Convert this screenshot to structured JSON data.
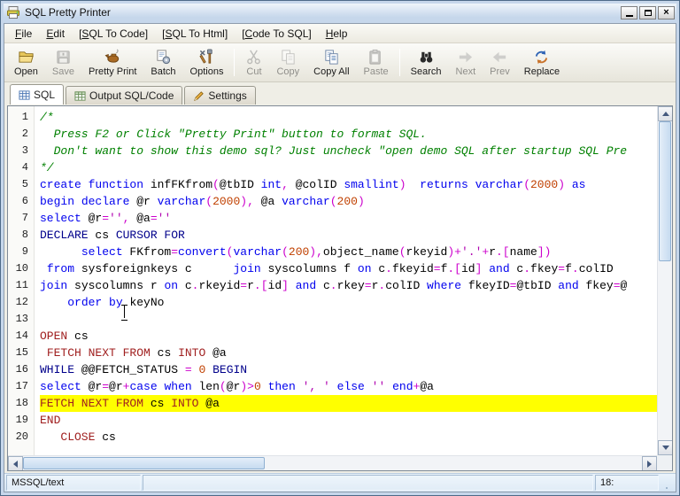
{
  "window": {
    "title": "SQL Pretty Printer"
  },
  "menu": {
    "items": [
      {
        "id": "file",
        "label": "File",
        "u": 0
      },
      {
        "id": "edit",
        "label": "Edit",
        "u": 0
      },
      {
        "id": "sql-to-code",
        "label": "[SQL To Code]",
        "u": 1
      },
      {
        "id": "sql-to-html",
        "label": "[SQL To Html]",
        "u": 1
      },
      {
        "id": "code-to-sql",
        "label": "[Code To SQL]",
        "u": 1
      },
      {
        "id": "help",
        "label": "Help",
        "u": 0
      }
    ]
  },
  "toolbar": {
    "buttons": [
      {
        "id": "open",
        "label": "Open",
        "icon": "open-folder-icon",
        "enabled": true
      },
      {
        "id": "save",
        "label": "Save",
        "icon": "save-icon",
        "enabled": false
      },
      {
        "id": "pretty-print",
        "label": "Pretty Print",
        "icon": "lamp-icon",
        "enabled": true
      },
      {
        "id": "batch",
        "label": "Batch",
        "icon": "batch-icon",
        "enabled": true
      },
      {
        "id": "options",
        "label": "Options",
        "icon": "tools-icon",
        "enabled": true
      },
      {
        "sep": true
      },
      {
        "id": "cut",
        "label": "Cut",
        "icon": "scissors-icon",
        "enabled": false
      },
      {
        "id": "copy",
        "label": "Copy",
        "icon": "copy-icon",
        "enabled": false
      },
      {
        "id": "copy-all",
        "label": "Copy All",
        "icon": "copy-all-icon",
        "enabled": true
      },
      {
        "id": "paste",
        "label": "Paste",
        "icon": "paste-icon",
        "enabled": false
      },
      {
        "sep": true
      },
      {
        "id": "search",
        "label": "Search",
        "icon": "binoculars-icon",
        "enabled": true
      },
      {
        "id": "next",
        "label": "Next",
        "icon": "next-arrow-icon",
        "enabled": false
      },
      {
        "id": "prev",
        "label": "Prev",
        "icon": "prev-arrow-icon",
        "enabled": false
      },
      {
        "id": "replace",
        "label": "Replace",
        "icon": "replace-icon",
        "enabled": true
      }
    ]
  },
  "tabs": [
    {
      "id": "sql",
      "label": "SQL",
      "icon": "grid-icon",
      "active": true
    },
    {
      "id": "output-sql-code",
      "label": "Output SQL/Code",
      "icon": "output-grid-icon",
      "active": false
    },
    {
      "id": "settings",
      "label": "Settings",
      "icon": "pencil-icon",
      "active": false
    }
  ],
  "editor": {
    "highlight_color": "#FFFF00",
    "lines": [
      {
        "n": 1,
        "s": [
          [
            "c",
            "/*"
          ]
        ]
      },
      {
        "n": 2,
        "s": [
          [
            "c",
            "  Press F2 or Click \"Pretty Print\" button to format SQL."
          ]
        ]
      },
      {
        "n": 3,
        "s": [
          [
            "c",
            "  Don't want to show this demo sql? Just uncheck \"open demo SQL after startup SQL Pre"
          ]
        ]
      },
      {
        "n": 4,
        "s": [
          [
            "c",
            "*/"
          ]
        ]
      },
      {
        "n": 5,
        "s": [
          [
            "k",
            "create function"
          ],
          [
            "t",
            " infFKfrom"
          ],
          [
            "p",
            "("
          ],
          [
            "t",
            "@tbID "
          ],
          [
            "k",
            "int"
          ],
          [
            "p",
            ","
          ],
          [
            "t",
            " @colID "
          ],
          [
            "k",
            "smallint"
          ],
          [
            "p",
            ")"
          ],
          [
            "t",
            "  "
          ],
          [
            "k",
            "returns"
          ],
          [
            "t",
            " "
          ],
          [
            "k",
            "varchar"
          ],
          [
            "p",
            "("
          ],
          [
            "n",
            "2000"
          ],
          [
            "p",
            ")"
          ],
          [
            "t",
            " "
          ],
          [
            "k",
            "as"
          ]
        ]
      },
      {
        "n": 6,
        "s": [
          [
            "k",
            "begin"
          ],
          [
            "t",
            " "
          ],
          [
            "k",
            "declare"
          ],
          [
            "t",
            " @r "
          ],
          [
            "k",
            "varchar"
          ],
          [
            "p",
            "("
          ],
          [
            "n",
            "2000"
          ],
          [
            "p",
            "),"
          ],
          [
            "t",
            " @a "
          ],
          [
            "k",
            "varchar"
          ],
          [
            "p",
            "("
          ],
          [
            "n",
            "200"
          ],
          [
            "p",
            ")"
          ]
        ]
      },
      {
        "n": 7,
        "s": [
          [
            "k",
            "select"
          ],
          [
            "t",
            " @r"
          ],
          [
            "p",
            "="
          ],
          [
            "s",
            "''"
          ],
          [
            "p",
            ","
          ],
          [
            "t",
            " @a"
          ],
          [
            "p",
            "="
          ],
          [
            "s",
            "''"
          ]
        ]
      },
      {
        "n": 8,
        "s": [
          [
            "v",
            "DECLARE"
          ],
          [
            "t",
            " cs "
          ],
          [
            "v",
            "CURSOR FOR"
          ]
        ]
      },
      {
        "n": 9,
        "s": [
          [
            "t",
            "      "
          ],
          [
            "k",
            "select"
          ],
          [
            "t",
            " FKfrom"
          ],
          [
            "p",
            "="
          ],
          [
            "k",
            "convert"
          ],
          [
            "p",
            "("
          ],
          [
            "k",
            "varchar"
          ],
          [
            "p",
            "("
          ],
          [
            "n",
            "200"
          ],
          [
            "p",
            "),"
          ],
          [
            "t",
            "object_name"
          ],
          [
            "p",
            "("
          ],
          [
            "t",
            "rkeyid"
          ],
          [
            "p",
            ")+"
          ],
          [
            "s",
            "'.'"
          ],
          [
            "p",
            "+"
          ],
          [
            "t",
            "r"
          ],
          [
            "p",
            ".["
          ],
          [
            "t",
            "name"
          ],
          [
            "p",
            "])"
          ]
        ]
      },
      {
        "n": 10,
        "s": [
          [
            "t",
            " "
          ],
          [
            "k",
            "from"
          ],
          [
            "t",
            " sysforeignkeys c      "
          ],
          [
            "k",
            "join"
          ],
          [
            "t",
            " syscolumns f "
          ],
          [
            "k",
            "on"
          ],
          [
            "t",
            " c"
          ],
          [
            "p",
            "."
          ],
          [
            "t",
            "fkeyid"
          ],
          [
            "p",
            "="
          ],
          [
            "t",
            "f"
          ],
          [
            "p",
            ".["
          ],
          [
            "t",
            "id"
          ],
          [
            "p",
            "]"
          ],
          [
            "t",
            " "
          ],
          [
            "k",
            "and"
          ],
          [
            "t",
            " c"
          ],
          [
            "p",
            "."
          ],
          [
            "t",
            "fkey"
          ],
          [
            "p",
            "="
          ],
          [
            "t",
            "f"
          ],
          [
            "p",
            "."
          ],
          [
            "t",
            "colID"
          ]
        ]
      },
      {
        "n": 11,
        "s": [
          [
            "k",
            "join"
          ],
          [
            "t",
            " syscolumns r "
          ],
          [
            "k",
            "on"
          ],
          [
            "t",
            " c"
          ],
          [
            "p",
            "."
          ],
          [
            "t",
            "rkeyid"
          ],
          [
            "p",
            "="
          ],
          [
            "t",
            "r"
          ],
          [
            "p",
            ".["
          ],
          [
            "t",
            "id"
          ],
          [
            "p",
            "]"
          ],
          [
            "t",
            " "
          ],
          [
            "k",
            "and"
          ],
          [
            "t",
            " c"
          ],
          [
            "p",
            "."
          ],
          [
            "t",
            "rkey"
          ],
          [
            "p",
            "="
          ],
          [
            "t",
            "r"
          ],
          [
            "p",
            "."
          ],
          [
            "t",
            "colID "
          ],
          [
            "k",
            "where"
          ],
          [
            "t",
            " fkeyID"
          ],
          [
            "p",
            "="
          ],
          [
            "t",
            "@tbID "
          ],
          [
            "k",
            "and"
          ],
          [
            "t",
            " fkey"
          ],
          [
            "p",
            "="
          ],
          [
            "t",
            "@"
          ]
        ]
      },
      {
        "n": 12,
        "s": [
          [
            "t",
            "    "
          ],
          [
            "k",
            "order"
          ],
          [
            "t",
            " "
          ],
          [
            "k",
            "by"
          ],
          [
            "t",
            " keyNo"
          ]
        ]
      },
      {
        "n": 13,
        "s": []
      },
      {
        "n": 14,
        "s": [
          [
            "r",
            "OPEN"
          ],
          [
            "t",
            " cs"
          ]
        ]
      },
      {
        "n": 15,
        "s": [
          [
            "t",
            " "
          ],
          [
            "r",
            "FETCH NEXT FROM"
          ],
          [
            "t",
            " cs "
          ],
          [
            "r",
            "INTO"
          ],
          [
            "t",
            " @a"
          ]
        ]
      },
      {
        "n": 16,
        "s": [
          [
            "v",
            "WHILE"
          ],
          [
            "t",
            " @@FETCH_STATUS "
          ],
          [
            "p",
            "="
          ],
          [
            "t",
            " "
          ],
          [
            "n",
            "0"
          ],
          [
            "t",
            " "
          ],
          [
            "v",
            "BEGIN"
          ]
        ]
      },
      {
        "n": 17,
        "s": [
          [
            "k",
            "select"
          ],
          [
            "t",
            " @r"
          ],
          [
            "p",
            "="
          ],
          [
            "t",
            "@r"
          ],
          [
            "p",
            "+"
          ],
          [
            "k",
            "case"
          ],
          [
            "t",
            " "
          ],
          [
            "k",
            "when"
          ],
          [
            "t",
            " len"
          ],
          [
            "p",
            "("
          ],
          [
            "t",
            "@r"
          ],
          [
            "p",
            ")>"
          ],
          [
            "n",
            "0"
          ],
          [
            "t",
            " "
          ],
          [
            "k",
            "then"
          ],
          [
            "t",
            " "
          ],
          [
            "s",
            "', '"
          ],
          [
            "t",
            " "
          ],
          [
            "k",
            "else"
          ],
          [
            "t",
            " "
          ],
          [
            "s",
            "''"
          ],
          [
            "t",
            " "
          ],
          [
            "k",
            "end"
          ],
          [
            "p",
            "+"
          ],
          [
            "t",
            "@a"
          ]
        ]
      },
      {
        "n": 18,
        "hl": true,
        "s": [
          [
            "r",
            "FETCH NEXT FROM"
          ],
          [
            "t",
            " cs "
          ],
          [
            "r",
            "INTO"
          ],
          [
            "t",
            " @a"
          ]
        ]
      },
      {
        "n": 19,
        "s": [
          [
            "r",
            "END"
          ]
        ]
      },
      {
        "n": 20,
        "s": [
          [
            "t",
            "   "
          ],
          [
            "r",
            "CLOSE"
          ],
          [
            "t",
            " cs"
          ]
        ]
      }
    ]
  },
  "statusbar": {
    "left": "MSSQL/text",
    "middle": "",
    "right": "18:"
  }
}
